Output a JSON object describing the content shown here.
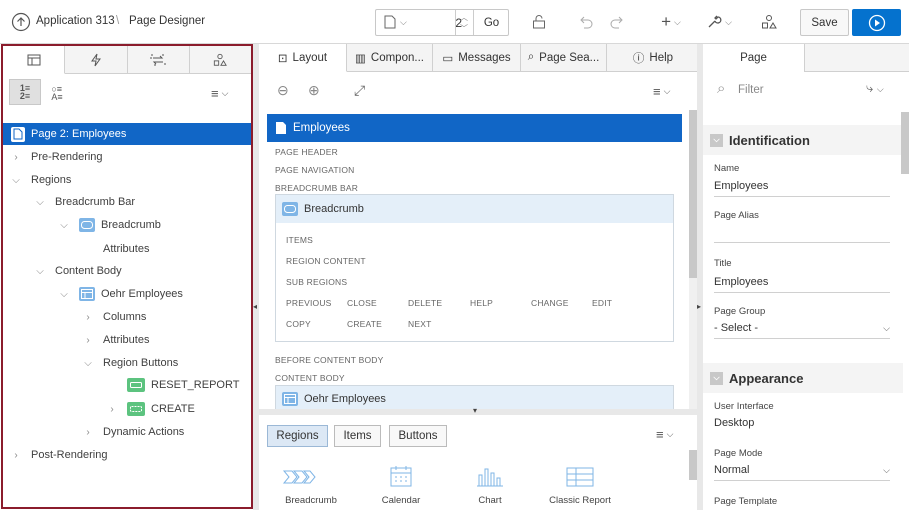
{
  "header": {
    "app_name": "Application 313",
    "separator": "\\",
    "page_designer": "Page Designer",
    "page_number": "2",
    "go_label": "Go",
    "save_label": "Save"
  },
  "left": {
    "tabs": [
      "rendering-tab",
      "dynamic-actions-tab",
      "processing-tab",
      "shared-components-tab"
    ],
    "tree": [
      {
        "label": "Page 2: Employees",
        "selected": true
      },
      {
        "label": "Pre-Rendering"
      },
      {
        "label": "Regions"
      },
      {
        "label": "Breadcrumb Bar"
      },
      {
        "label": "Breadcrumb"
      },
      {
        "label": "Attributes"
      },
      {
        "label": "Content Body"
      },
      {
        "label": "Oehr Employees"
      },
      {
        "label": "Columns"
      },
      {
        "label": "Attributes"
      },
      {
        "label": "Region Buttons"
      },
      {
        "label": "RESET_REPORT"
      },
      {
        "label": "CREATE"
      },
      {
        "label": "Dynamic Actions"
      },
      {
        "label": "Post-Rendering"
      }
    ]
  },
  "middle": {
    "tabs": [
      "Layout",
      "Compon...",
      "Messages",
      "Page Sea...",
      "Help"
    ],
    "page_title": "Employees",
    "page_header": "PAGE HEADER",
    "page_navigation": "PAGE NAVIGATION",
    "breadcrumb_bar": "BREADCRUMB BAR",
    "breadcrumb": "Breadcrumb",
    "items": "ITEMS",
    "region_content": "REGION CONTENT",
    "sub_regions": "SUB REGIONS",
    "positions": [
      "PREVIOUS",
      "CLOSE",
      "DELETE",
      "HELP",
      "CHANGE",
      "EDIT",
      "COPY",
      "CREATE",
      "NEXT"
    ],
    "before_content_body": "BEFORE CONTENT BODY",
    "content_body": "CONTENT BODY",
    "oehr": "Oehr Employees",
    "gallery_tabs": [
      "Regions",
      "Items",
      "Buttons"
    ],
    "gallery": [
      "Breadcrumb",
      "Calendar",
      "Chart",
      "Classic Report"
    ]
  },
  "right": {
    "tab": "Page",
    "filter_placeholder": "Filter",
    "identification": "Identification",
    "name_label": "Name",
    "name_value": "Employees",
    "alias_label": "Page Alias",
    "alias_value": "",
    "title_label": "Title",
    "title_value": "Employees",
    "group_label": "Page Group",
    "group_value": "- Select -",
    "appearance": "Appearance",
    "ui_label": "User Interface",
    "ui_value": "Desktop",
    "mode_label": "Page Mode",
    "mode_value": "Normal",
    "template_label": "Page Template"
  },
  "colors": {
    "accent": "#0572ce",
    "selected": "#1166c6",
    "border_highlight": "#8b1c2c"
  }
}
